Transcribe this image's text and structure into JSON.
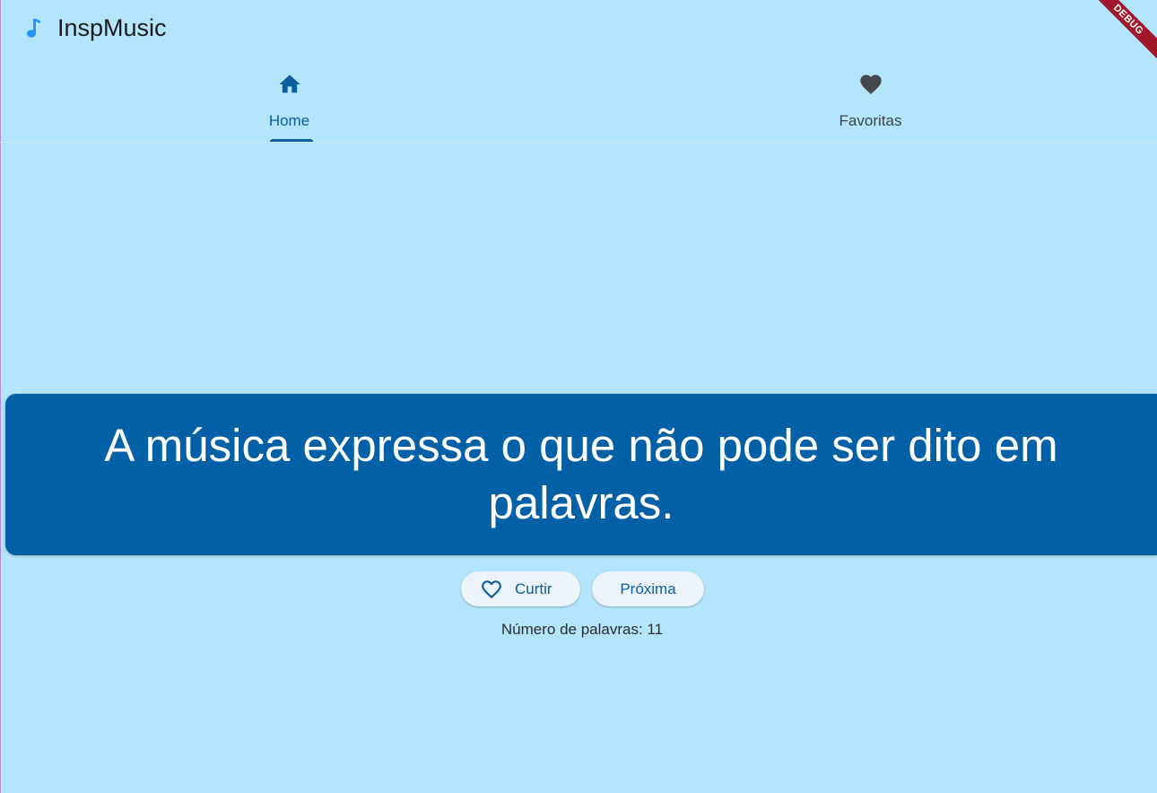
{
  "app": {
    "title": "InspMusic",
    "icon": "music-note-icon"
  },
  "tabs": [
    {
      "label": "Home",
      "icon": "home-icon",
      "selected": true
    },
    {
      "label": "Favoritas",
      "icon": "heart-icon",
      "selected": false
    }
  ],
  "quote": {
    "text": "A música expressa o que não pode ser dito em palavras."
  },
  "actions": {
    "like_label": "Curtir",
    "like_icon": "heart-outline-icon",
    "next_label": "Próxima"
  },
  "word_count": {
    "text": "Número de palavras: 11"
  },
  "debug_banner": "DEBUG",
  "colors": {
    "background": "#b3e5fc",
    "primary": "#0a5fa0",
    "card": "#0160a6",
    "button_bg": "#edf3fa",
    "debug": "#a0182a"
  }
}
